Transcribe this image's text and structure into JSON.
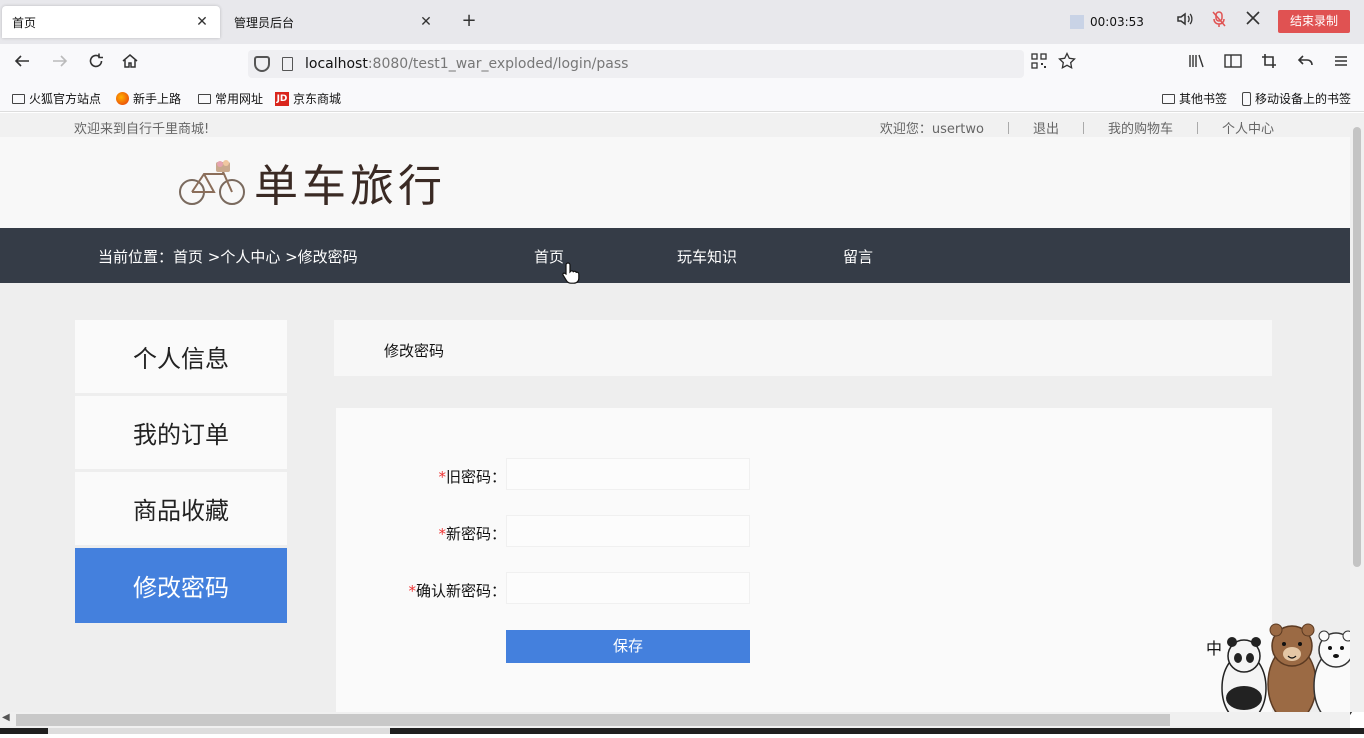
{
  "browser": {
    "tabs": [
      {
        "title": "首页",
        "active": true
      },
      {
        "title": "管理员后台",
        "active": false
      }
    ],
    "close_glyph": "✕",
    "newtab_glyph": "+",
    "recording": {
      "time": "00:03:53",
      "stop_label": "结束录制"
    },
    "url_host": "localhost",
    "url_rest": ":8080/test1_war_exploded/login/pass",
    "bookmarks": [
      {
        "label": "火狐官方站点",
        "icon": "folder-icon"
      },
      {
        "label": "新手上路",
        "icon": "firefox-icon"
      },
      {
        "label": "常用网址",
        "icon": "folder-icon"
      },
      {
        "label": "京东商城",
        "icon": "jd-icon"
      }
    ],
    "bookmarks_right": [
      {
        "label": "其他书签",
        "icon": "folder-icon"
      },
      {
        "label": "移动设备上的书签",
        "icon": "mobile-icon"
      }
    ],
    "jd_badge": "JD"
  },
  "site": {
    "welcome": "欢迎来到自行千里商城!",
    "user_greeting": "欢迎您：usertwo",
    "logout": "退出",
    "cart": "我的购物车",
    "personal_center": "个人中心",
    "logo_text": "单车旅行",
    "breadcrumb": "当前位置：首页 >个人中心 >修改密码",
    "nav": [
      "首页",
      "玩车知识",
      "留言"
    ]
  },
  "sidebar": {
    "items": [
      {
        "label": "个人信息",
        "active": false
      },
      {
        "label": "我的订单",
        "active": false
      },
      {
        "label": "商品收藏",
        "active": false
      },
      {
        "label": "修改密码",
        "active": true
      }
    ]
  },
  "form": {
    "title": "修改密码",
    "required_mark": "*",
    "old_password_label": "旧密码：",
    "new_password_label": "新密码：",
    "confirm_password_label": "确认新密码：",
    "old_password_value": "",
    "new_password_value": "",
    "confirm_password_value": "",
    "save_label": "保存"
  },
  "widget": {
    "ime_char": "中"
  },
  "colors": {
    "nav_bg": "#353c47",
    "accent": "#4480dd",
    "record_red": "#e05252",
    "required": "#e33333"
  }
}
